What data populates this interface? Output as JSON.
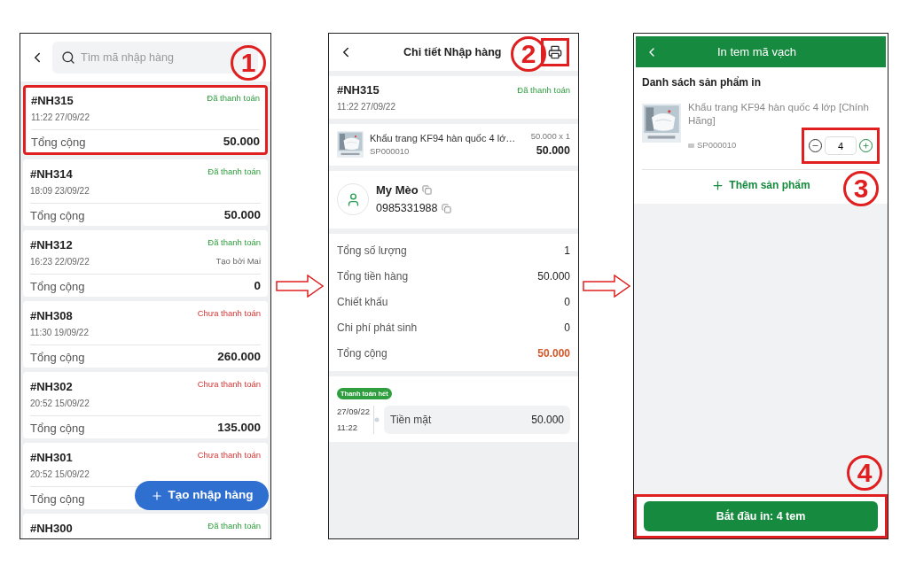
{
  "list_screen": {
    "step": "1",
    "search": {
      "placeholder": "Tìm mã nhập hàng"
    },
    "orders": [
      {
        "code": "#NH315",
        "status": "Đã thanh toán",
        "paid": true,
        "time": "11:22 27/09/22",
        "total_label": "Tổng cộng",
        "total": "50.000",
        "highlighted": true
      },
      {
        "code": "#NH314",
        "status": "Đã thanh toán",
        "paid": true,
        "time": "18:09 23/09/22",
        "total_label": "Tổng cộng",
        "total": "50.000",
        "highlighted": false
      },
      {
        "code": "#NH312",
        "status": "Đã thanh toán",
        "paid": true,
        "time": "16:23 22/09/22",
        "note": "Tạo bởi Mai",
        "total_label": "Tổng cộng",
        "total": "0",
        "highlighted": false
      },
      {
        "code": "#NH308",
        "status": "Chưa thanh toán",
        "paid": false,
        "time": "11:30 19/09/22",
        "total_label": "Tổng cộng",
        "total": "260.000",
        "highlighted": false
      },
      {
        "code": "#NH302",
        "status": "Chưa thanh toán",
        "paid": false,
        "time": "20:52 15/09/22",
        "total_label": "Tổng cộng",
        "total": "135.000",
        "highlighted": false
      },
      {
        "code": "#NH301",
        "status": "Chưa thanh toán",
        "paid": false,
        "time": "20:52 15/09/22",
        "total_label": "Tổng cộng",
        "highlighted": false
      },
      {
        "code": "#NH300",
        "status": "Đã thanh toán",
        "paid": true,
        "highlighted": false
      }
    ],
    "create_button": "Tạo nhập hàng"
  },
  "detail_screen": {
    "step": "2",
    "title": "Chi tiết Nhập hàng",
    "print_highlighted": true,
    "order": {
      "code": "#NH315",
      "status": "Đã thanh toán",
      "paid": true,
      "time": "11:22 27/09/22"
    },
    "product": {
      "name": "Khẩu trang KF94 hàn quốc 4 lớ…",
      "sku": "SP000010",
      "price_qty": "50.000 x 1",
      "amount": "50.000"
    },
    "supplier": {
      "name": "My Mèo",
      "phone": "0985331988"
    },
    "summary": [
      {
        "label": "Tổng số lượng",
        "value": "1",
        "emphasis": false
      },
      {
        "label": "Tổng tiền hàng",
        "value": "50.000",
        "emphasis": false
      },
      {
        "label": "Chiết khấu",
        "value": "0",
        "emphasis": false
      },
      {
        "label": "Chi phí phát sinh",
        "value": "0",
        "emphasis": false
      },
      {
        "label": "Tổng cộng",
        "value": "50.000",
        "emphasis": true
      }
    ],
    "payment": {
      "badge": "Thanh toán hết",
      "date": "27/09/22",
      "time": "11:22",
      "method": "Tiền mặt",
      "amount": "50.000"
    }
  },
  "print_screen": {
    "step": "3",
    "finish_step": "4",
    "title": "In tem mã vạch",
    "section_title": "Danh sách sản phẩm in",
    "items": [
      {
        "name": "Khẩu trang KF94 hàn quốc 4 lớp [Chính Hãng]",
        "sku": "SP000010",
        "quantity": "4"
      }
    ],
    "add_label": "Thêm sản phẩm",
    "start_button": "Bắt đầu in: 4 tem",
    "stepper_highlighted": true,
    "button_highlighted": true
  }
}
